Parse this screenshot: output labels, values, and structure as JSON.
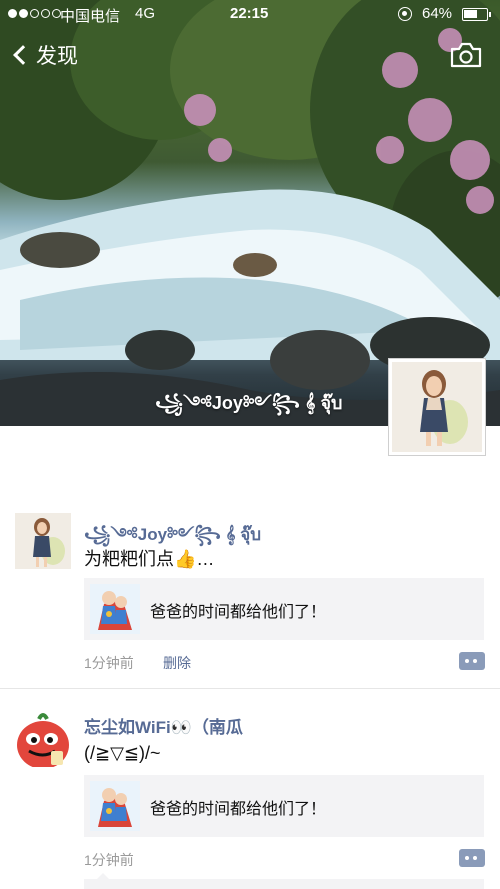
{
  "status_bar": {
    "signal_filled": 2,
    "signal_total": 5,
    "carrier": "中国电信",
    "network": "4G",
    "time": "22:15",
    "battery": "64%",
    "battery_level": 0.64
  },
  "nav": {
    "back_label": "发现",
    "back_icon": "chevron-left-icon",
    "camera_icon": "camera-icon"
  },
  "profile": {
    "name": "꧁༺Joy༻꧂ 𝄞 จุ๊บ",
    "avatar": "cartoon-girl-avatar"
  },
  "posts": [
    {
      "author": "꧁༺Joy༻꧂ 𝄞 จุ๊บ",
      "text": "为粑粑们点👍…",
      "link_title": "爸爸的时间都给他们了！",
      "time": "1分钟前",
      "delete_label": "删除"
    },
    {
      "author": "忘尘如WiFi👀（南瓜",
      "text": "(/≧▽≦)/~",
      "link_title": "爸爸的时间都给他们了！",
      "time": "1分钟前"
    }
  ],
  "colors": {
    "link_blue": "#576b95",
    "card_bg": "#f3f3f5",
    "comment_button": "#8a9bb9"
  }
}
